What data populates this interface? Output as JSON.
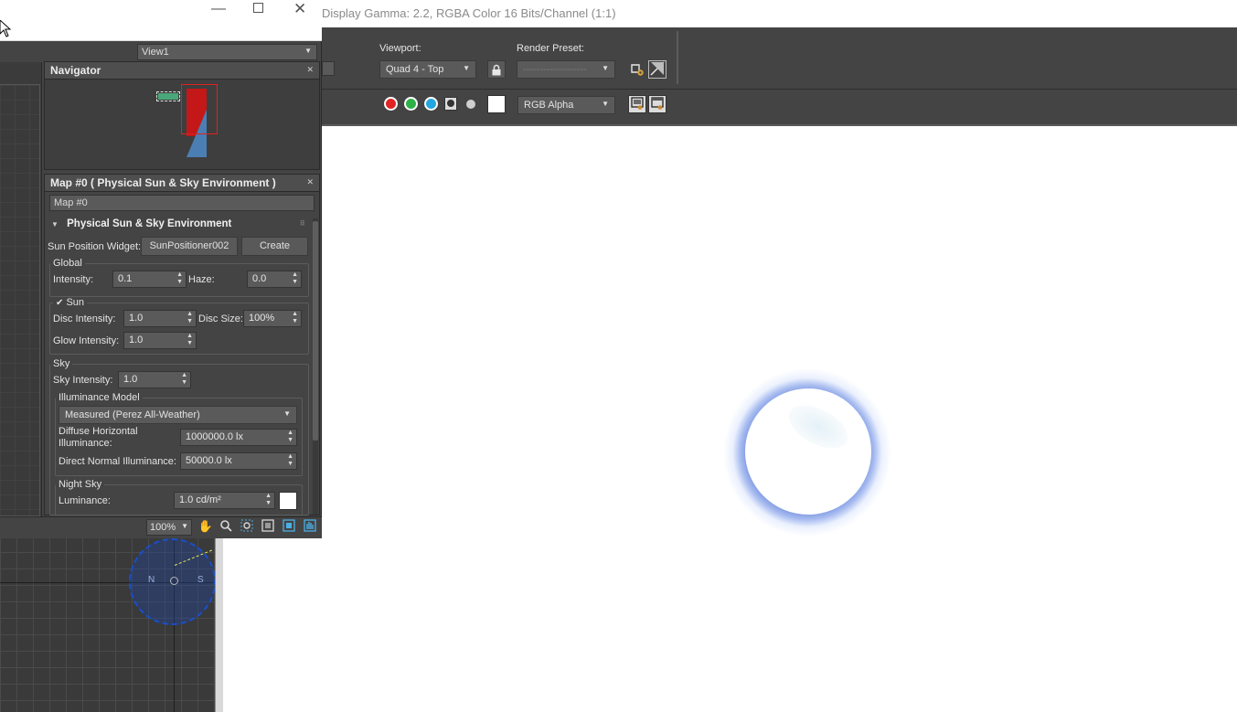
{
  "render_frame": {
    "title": "Display Gamma: 2.2, RGBA Color 16 Bits/Channel (1:1)",
    "viewport_label": "Viewport:",
    "viewport_value": "Quad 4 - Top",
    "render_preset_label": "Render Preset:",
    "render_preset_value": "-------------------",
    "channel_value": "RGB Alpha",
    "channel_colors": {
      "red": "#e02424",
      "green": "#2fb14a",
      "blue": "#22a7e0"
    }
  },
  "sme": {
    "view_select": "View1",
    "navigator_title": "Navigator",
    "param_title": "Map #0  ( Physical Sun & Sky Environment )",
    "map_name": "Map #0",
    "rollout_title": "Physical Sun & Sky Environment",
    "sun_widget_label": "Sun Position Widget:",
    "sun_widget_value": "SunPositioner002",
    "create_label": "Create",
    "global": {
      "title": "Global",
      "intensity_label": "Intensity:",
      "intensity_value": "0.1",
      "haze_label": "Haze:",
      "haze_value": "0.0"
    },
    "sun": {
      "title": "Sun",
      "checked": true,
      "disc_intensity_label": "Disc Intensity:",
      "disc_intensity_value": "1.0",
      "disc_size_label": "Disc Size:",
      "disc_size_value": "100%",
      "glow_intensity_label": "Glow Intensity:",
      "glow_intensity_value": "1.0"
    },
    "sky": {
      "title": "Sky",
      "sky_intensity_label": "Sky Intensity:",
      "sky_intensity_value": "1.0",
      "illuminance_model_title": "Illuminance Model",
      "illuminance_model_value": "Measured (Perez All-Weather)",
      "diffuse_label_1": "Diffuse Horizontal",
      "diffuse_label_2": "Illuminance:",
      "diffuse_value": "1000000.0 lx",
      "direct_label": "Direct Normal Illuminance:",
      "direct_value": "50000.0 lx"
    },
    "night_sky": {
      "title": "Night Sky",
      "luminance_label": "Luminance:",
      "luminance_value": "1.0 cd/m²"
    },
    "zoom_value": "100%"
  },
  "viewport": {
    "compass_n": "N",
    "compass_s": "S"
  }
}
